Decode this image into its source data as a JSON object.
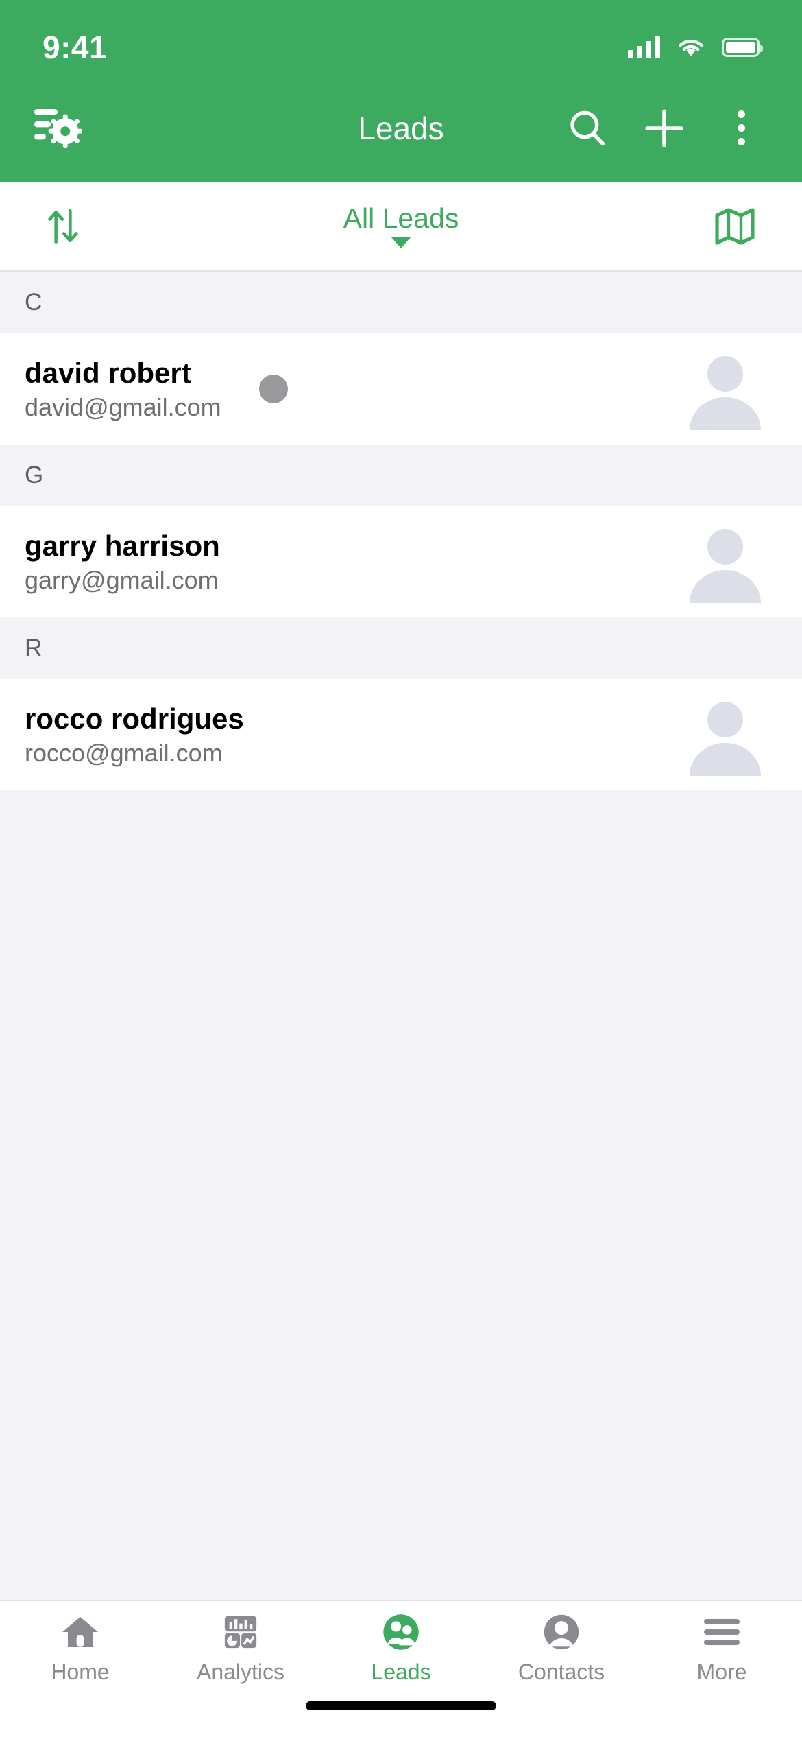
{
  "statusbar": {
    "time": "9:41",
    "signal_icon": "cellular-signal-icon",
    "wifi_icon": "wifi-icon",
    "battery_icon": "battery-icon"
  },
  "navbar": {
    "title": "Leads",
    "filter_settings_icon": "filter-settings-icon",
    "search_icon": "search-icon",
    "add_icon": "plus-icon",
    "overflow_icon": "more-vertical-icon"
  },
  "filterbar": {
    "sort_icon": "sort-arrows-icon",
    "label": "All Leads",
    "caret_icon": "chevron-down-icon",
    "map_icon": "map-icon"
  },
  "colors": {
    "brand_green": "#3DAB5F",
    "page_background": "#F2F2F7",
    "row_background": "#FFFFFF",
    "avatar_placeholder": "#DCDEE8",
    "status_dot": "#9A9A9D",
    "inactive_tab": "#8A8A8F"
  },
  "list": {
    "sections": [
      {
        "letter": "C",
        "rows": [
          {
            "name": "david robert",
            "email": "david@gmail.com",
            "status_dot": true
          }
        ]
      },
      {
        "letter": "G",
        "rows": [
          {
            "name": "garry harrison",
            "email": "garry@gmail.com",
            "status_dot": false
          }
        ]
      },
      {
        "letter": "R",
        "rows": [
          {
            "name": "rocco rodrigues",
            "email": "rocco@gmail.com",
            "status_dot": false
          }
        ]
      }
    ]
  },
  "tabbar": {
    "tabs": [
      {
        "label": "Home",
        "icon": "home-icon",
        "active": false
      },
      {
        "label": "Analytics",
        "icon": "analytics-icon",
        "active": false
      },
      {
        "label": "Leads",
        "icon": "leads-icon",
        "active": true
      },
      {
        "label": "Contacts",
        "icon": "contacts-icon",
        "active": false
      },
      {
        "label": "More",
        "icon": "hamburger-menu-icon",
        "active": false
      }
    ]
  }
}
